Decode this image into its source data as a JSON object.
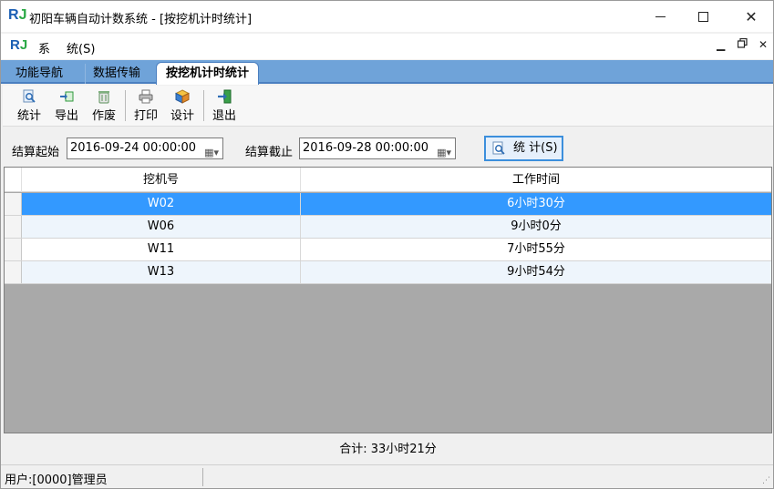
{
  "window": {
    "logo_r": "R",
    "logo_j": "J",
    "title": "初阳车辆自动计数系统 - [按挖机计时统计]",
    "minimize": "—",
    "close": "✕"
  },
  "menu": {
    "items": [
      "系",
      "统(S)"
    ],
    "mdi_minimize": "▁",
    "mdi_restore": "🗗",
    "mdi_close": "✕"
  },
  "tabs": [
    {
      "label": "功能导航"
    },
    {
      "label": "数据传输"
    },
    {
      "label": "按挖机计时统计"
    }
  ],
  "toolbar": {
    "items": [
      {
        "label": "统计",
        "icon": "magnifier-icon"
      },
      {
        "label": "导出",
        "icon": "export-icon"
      },
      {
        "label": "作废",
        "icon": "trash-icon"
      },
      {
        "label": "打印",
        "icon": "printer-icon"
      },
      {
        "label": "设计",
        "icon": "design-icon"
      },
      {
        "label": "退出",
        "icon": "exit-icon"
      }
    ]
  },
  "filter": {
    "start_label": "结算起始",
    "start_value": "2016-09-24 00:00:00",
    "end_label": "结算截止",
    "end_value": "2016-09-28 00:00:00",
    "stat_button": "统 计(S)"
  },
  "grid": {
    "columns": [
      "挖机号",
      "工作时间"
    ],
    "rows": [
      [
        "W02",
        "6小时30分"
      ],
      [
        "W06",
        "9小时0分"
      ],
      [
        "W11",
        "7小时55分"
      ],
      [
        "W13",
        "9小时54分"
      ]
    ],
    "selected_row": 0
  },
  "total": "合计: 33小时21分",
  "status": {
    "user": "用户:[0000]管理员"
  },
  "colors": {
    "accent": "#3399ff",
    "tabstrip": "#6fa3d9",
    "logo_blue": "#1b5fb4",
    "logo_green": "#2aa845"
  }
}
